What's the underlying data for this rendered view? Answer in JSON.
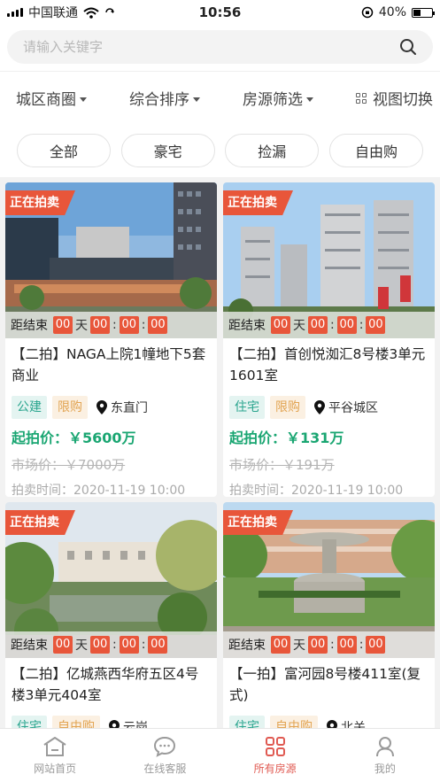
{
  "status": {
    "carrier": "中国联通",
    "time": "10:56",
    "battery": "40%",
    "battery_level": 0.4
  },
  "search": {
    "placeholder": "请输入关键字"
  },
  "filters": [
    {
      "label": "城区商圈"
    },
    {
      "label": "综合排序"
    },
    {
      "label": "房源筛选"
    },
    {
      "label": "视图切换"
    }
  ],
  "categories": [
    "全部",
    "豪宅",
    "捡漏",
    "自由购"
  ],
  "countdown_label": "距结束",
  "countdown_day_unit": "天",
  "auction_tag": "正在拍卖",
  "listings": [
    {
      "title": "【二拍】NAGA上院1幢地下5套商业",
      "type": "公建",
      "limit": "限购",
      "location": "东直门",
      "start_price": "起拍价：￥5600万",
      "market_price": "市场价：￥7000万",
      "auction_time": "拍卖时间：2020-11-19 10:00",
      "countdown": [
        "00",
        "00",
        "00",
        "00"
      ]
    },
    {
      "title": "【二拍】首创悦洳汇8号楼3单元1601室",
      "type": "住宅",
      "limit": "限购",
      "location": "平谷城区",
      "start_price": "起拍价：￥131万",
      "market_price": "市场价：￥191万",
      "auction_time": "拍卖时间：2020-11-19 10:00",
      "countdown": [
        "00",
        "00",
        "00",
        "00"
      ]
    },
    {
      "title": "【二拍】亿城燕西华府五区4号楼3单元404室",
      "type": "住宅",
      "limit": "自由购",
      "location": "云岗",
      "countdown": [
        "00",
        "00",
        "00",
        "00"
      ]
    },
    {
      "title": "【一拍】富河园8号楼411室(复式)",
      "type": "住宅",
      "limit": "自由购",
      "location": "北关",
      "countdown": [
        "00",
        "00",
        "00",
        "00"
      ]
    }
  ],
  "tabs": [
    {
      "label": "网站首页",
      "icon": "home-icon"
    },
    {
      "label": "在线客服",
      "icon": "chat-icon"
    },
    {
      "label": "所有房源",
      "icon": "grid-icon",
      "active": true
    },
    {
      "label": "我的",
      "icon": "user-icon"
    }
  ],
  "colors": {
    "accent": "#e8563a",
    "price": "#1aa672",
    "tab_active": "#e05a52"
  }
}
